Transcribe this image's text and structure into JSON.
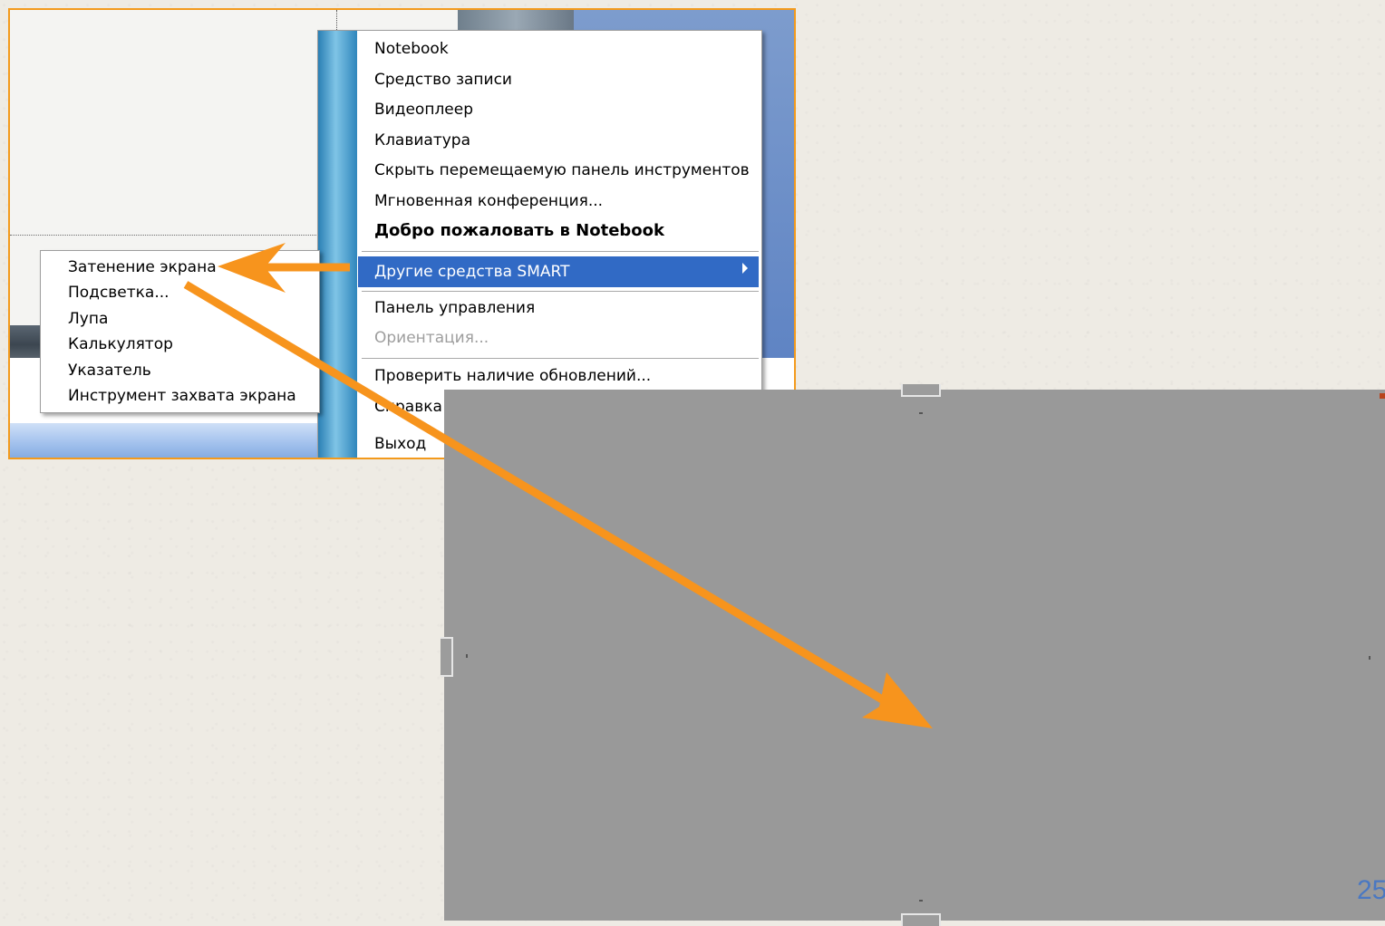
{
  "main_menu": {
    "items": [
      {
        "label": "Notebook"
      },
      {
        "label": "Средство записи"
      },
      {
        "label": "Видеоплеер"
      },
      {
        "label": "Клавиатура"
      },
      {
        "label": "Скрыть перемещаемую панель инструментов"
      },
      {
        "label": "Мгновенная конференция..."
      },
      {
        "label": "Добро пожаловать в Notebook"
      },
      {
        "label": "Другие средства SMART"
      },
      {
        "label": "Панель управления"
      },
      {
        "label": "Ориентация..."
      },
      {
        "label": "Проверить наличие обновлений..."
      },
      {
        "label": "Справка"
      },
      {
        "label": "Выход"
      }
    ]
  },
  "submenu": {
    "items": [
      {
        "label": "Затенение экрана"
      },
      {
        "label": "Подсветка..."
      },
      {
        "label": "Лупа"
      },
      {
        "label": "Калькулятор"
      },
      {
        "label": "Указатель"
      },
      {
        "label": "Инструмент захвата экрана"
      }
    ]
  },
  "slide": {
    "page_number": "25"
  },
  "colors": {
    "accent_arrow": "#f7941d",
    "menu_highlight": "#316ac5",
    "shade_gray": "#999999",
    "frame_border": "#f39a1c"
  }
}
